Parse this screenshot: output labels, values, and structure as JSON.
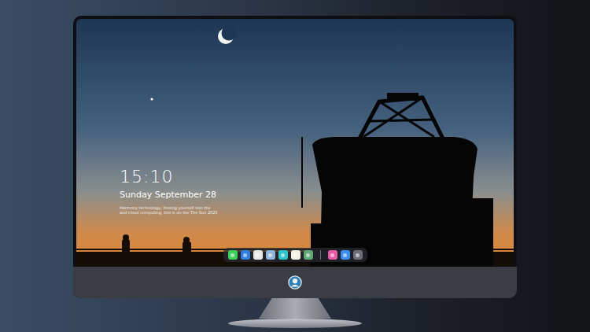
{
  "lockscreen": {
    "time": "15:10",
    "date": "Sunday September 28",
    "caption": [
      "Harmony technology, freeing yourself into the",
      "and cloud computing, this is on the The Sun 2025"
    ]
  },
  "dock": {
    "groups": [
      {
        "apps": [
          {
            "color": "#3ccf5c"
          },
          {
            "color": "#2f7fe0"
          },
          {
            "color": "#e8e8e8"
          },
          {
            "color": "#8fb4d8"
          },
          {
            "color": "#2fc4c8"
          },
          {
            "color": "#f4f1e6"
          },
          {
            "color": "#5fa878"
          }
        ]
      },
      {
        "apps": [
          {
            "color": "#e85aa8"
          },
          {
            "color": "#3a8ff0"
          },
          {
            "color": "#6d6f78"
          }
        ]
      }
    ]
  }
}
